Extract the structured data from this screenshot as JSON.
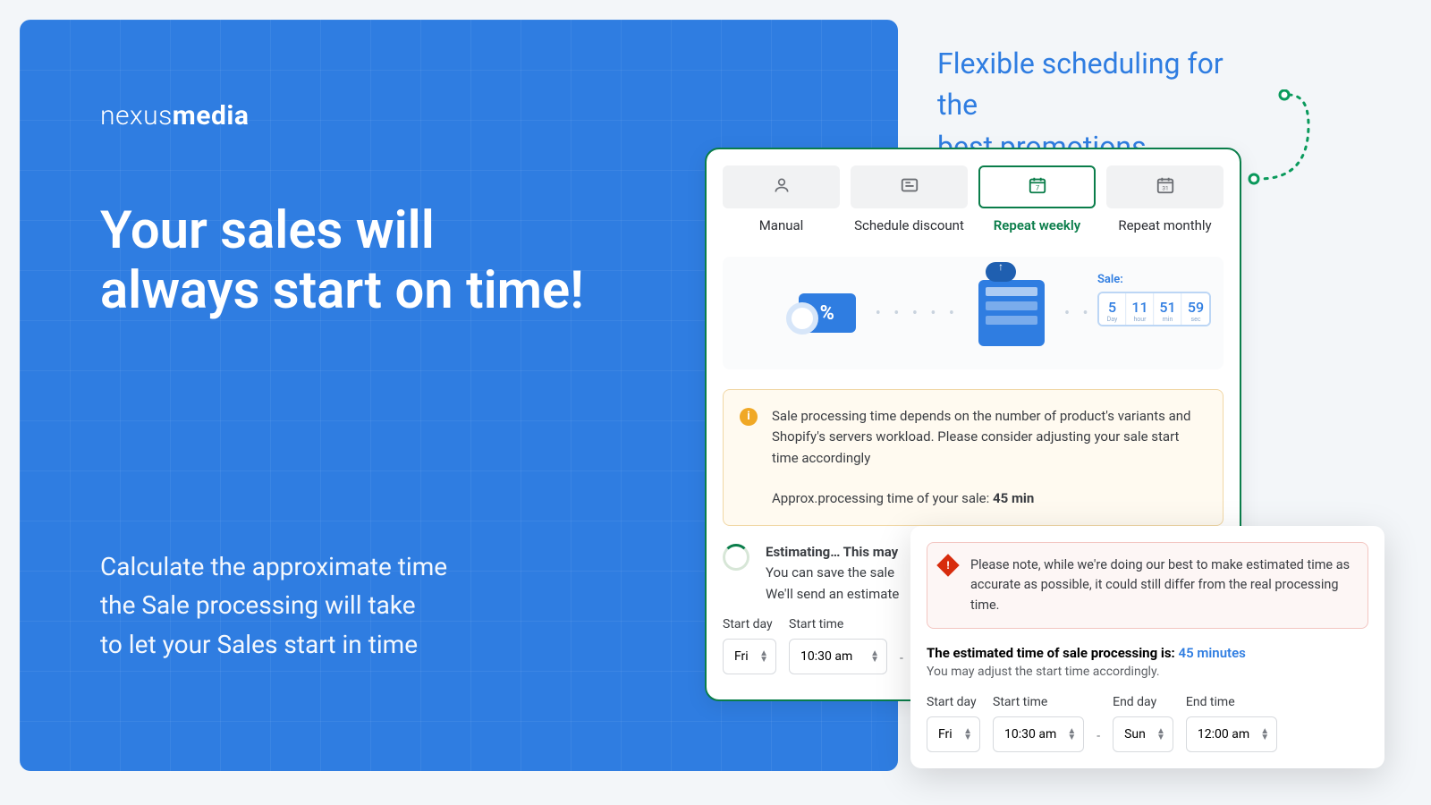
{
  "brand": {
    "prefix": "nexus",
    "bold": "media"
  },
  "hero": {
    "headline": "Your sales will always start on time!",
    "subtext_l1": "Calculate the approximate time",
    "subtext_l2": "the Sale processing will take",
    "subtext_l3": "to let your Sales start in time"
  },
  "right_heading_l1": "Flexible scheduling for the",
  "right_heading_l2": "best promotions planning",
  "tabs": {
    "manual": "Manual",
    "schedule": "Schedule discount",
    "weekly": "Repeat weekly",
    "monthly": "Repeat monthly"
  },
  "countdown": {
    "title": "Sale:",
    "cells": [
      {
        "n": "5",
        "u": "Day"
      },
      {
        "n": "11",
        "u": "hour"
      },
      {
        "n": "51",
        "u": "min"
      },
      {
        "n": "59",
        "u": "sec"
      }
    ]
  },
  "banner": {
    "text": "Sale processing time depends on the number of product's variants and Shopify's servers workload. Please consider adjusting your sale start time accordingly",
    "approx_label": "Approx.processing time of your sale: ",
    "approx_value": "45 min"
  },
  "estimating": {
    "title": "Estimating… This may",
    "line2": "You can save the sale",
    "line3": "We'll send an estimate"
  },
  "fields": {
    "start_day_label": "Start day",
    "start_time_label": "Start time",
    "end_day_label": "End day",
    "end_time_label": "End time",
    "start_day": "Fri",
    "start_time": "10:30 am",
    "end_day": "Sun",
    "end_time": "12:00 am"
  },
  "popup": {
    "alert": "Please note, while we're doing our best to make estimated time as accurate as possible, it could still differ from the real processing time.",
    "est_label": "The estimated time of sale processing is: ",
    "est_value": "45 minutes",
    "hint": "You may adjust the start time accordingly."
  }
}
